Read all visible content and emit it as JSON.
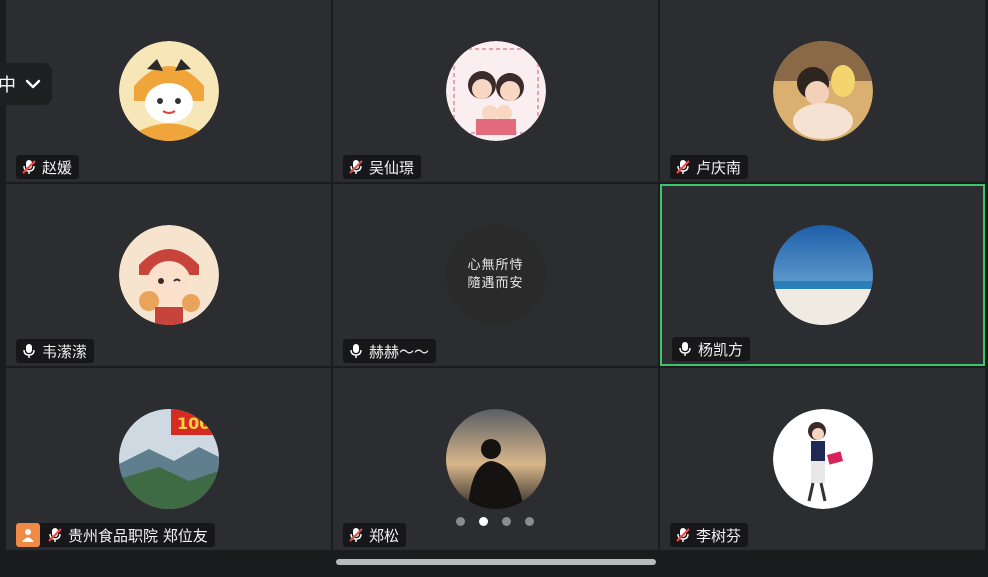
{
  "language_button": {
    "label": "中",
    "icon": "chevron-down-icon"
  },
  "accent_color": "#3ec46d",
  "participants": [
    {
      "name": "赵媛",
      "mic": "muted"
    },
    {
      "name": "吴仙璟",
      "mic": "muted"
    },
    {
      "name": "卢庆南",
      "mic": "muted"
    },
    {
      "name": "韦潆潆",
      "mic": "on"
    },
    {
      "name": "赫赫～～",
      "mic": "on",
      "avatar_text": [
        "心無所恃",
        "隨遇而安"
      ]
    },
    {
      "name": "杨凯方",
      "mic": "on",
      "speaking": true
    },
    {
      "name": "贵州食品职院 郑位友",
      "mic": "muted",
      "host": true
    },
    {
      "name": "郑松",
      "mic": "muted"
    },
    {
      "name": "李树芬",
      "mic": "muted"
    }
  ],
  "pagination": {
    "pages": 4,
    "current": 2
  }
}
